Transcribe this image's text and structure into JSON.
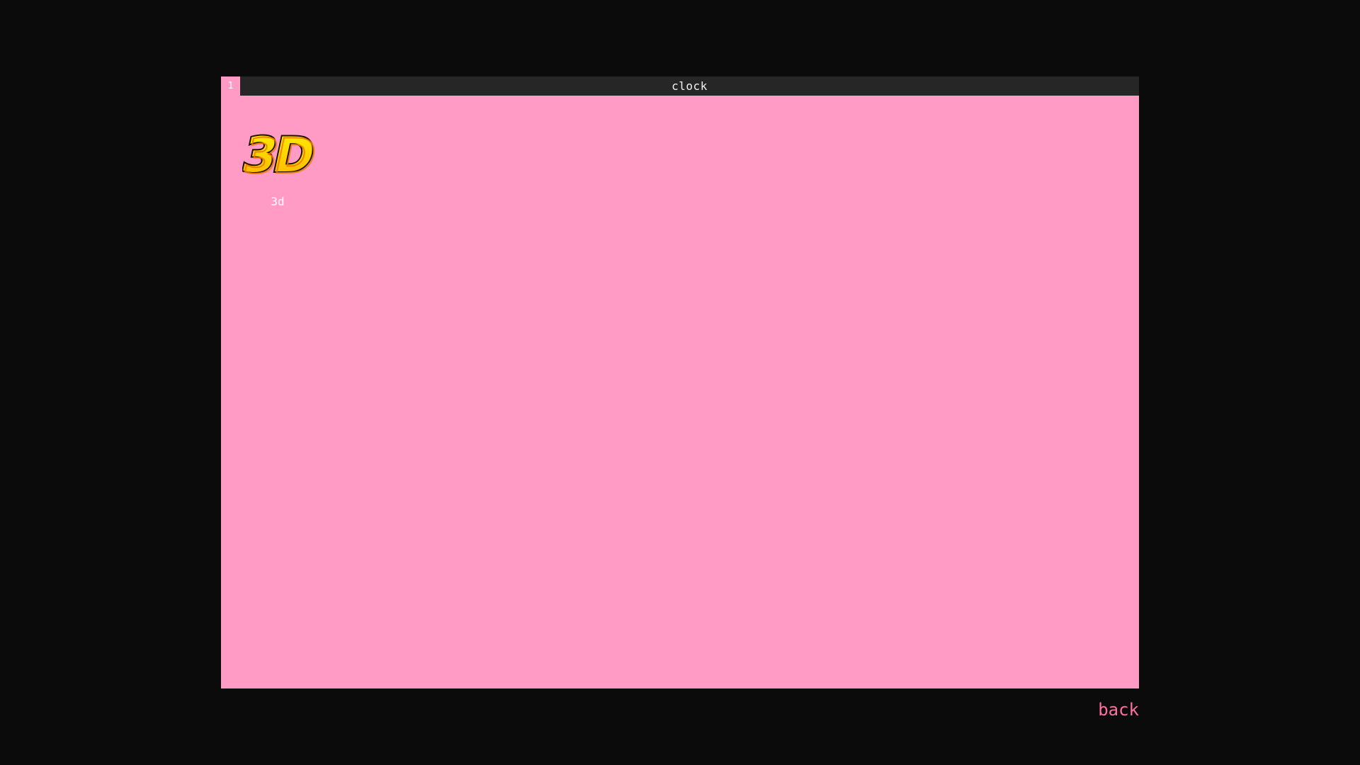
{
  "window": {
    "tab_number": "1",
    "title": "clock"
  },
  "app_items": [
    {
      "icon_name": "3d-icon",
      "icon_text": "3D",
      "label": "3d"
    }
  ],
  "footer": {
    "back_label": "back"
  },
  "colors": {
    "background": "#0b0b0b",
    "window_background": "#ff9bc5",
    "titlebar": "#262626",
    "back_link": "#ff6f9f",
    "icon_yellow": "#ffe600",
    "icon_orange": "#f07800"
  }
}
